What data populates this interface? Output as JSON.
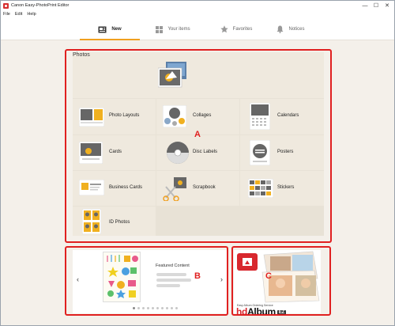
{
  "window": {
    "title": "Canon Easy-PhotoPrint Editor",
    "controls": [
      "—",
      "☐",
      "✕"
    ]
  },
  "menu": [
    "File",
    "Edit",
    "Help"
  ],
  "tabs": [
    {
      "label": "New",
      "icon": "new-icon",
      "active": true
    },
    {
      "label": "Your items",
      "icon": "grid-icon",
      "active": false
    },
    {
      "label": "Favorites",
      "icon": "star-icon",
      "active": false
    },
    {
      "label": "Notices",
      "icon": "bell-icon",
      "active": false
    }
  ],
  "categories": {
    "photos": "Photos",
    "photo_layouts": "Photo Layouts",
    "collages": "Collages",
    "calendars": "Calendars",
    "cards": "Cards",
    "disc_labels": "Disc Labels",
    "posters": "Posters",
    "business_cards": "Business Cards",
    "scrapbook": "Scrapbook",
    "stickers": "Stickers",
    "id_photos": "ID Photos"
  },
  "featured": {
    "title": "Featured Content",
    "prev": "‹",
    "next": "›",
    "page_count": 10,
    "current_page": 1
  },
  "album": {
    "tagline": "Easy Album Ordering Service",
    "logo_hd": "hd",
    "logo_album": "Album",
    "logo_ez": "EZ"
  },
  "markers": {
    "a": "A",
    "b": "B",
    "c": "C"
  },
  "colors": {
    "accent": "#f0a020",
    "highlight": "#e02020",
    "brand": "#d8282e",
    "background": "#f4f0ea"
  }
}
